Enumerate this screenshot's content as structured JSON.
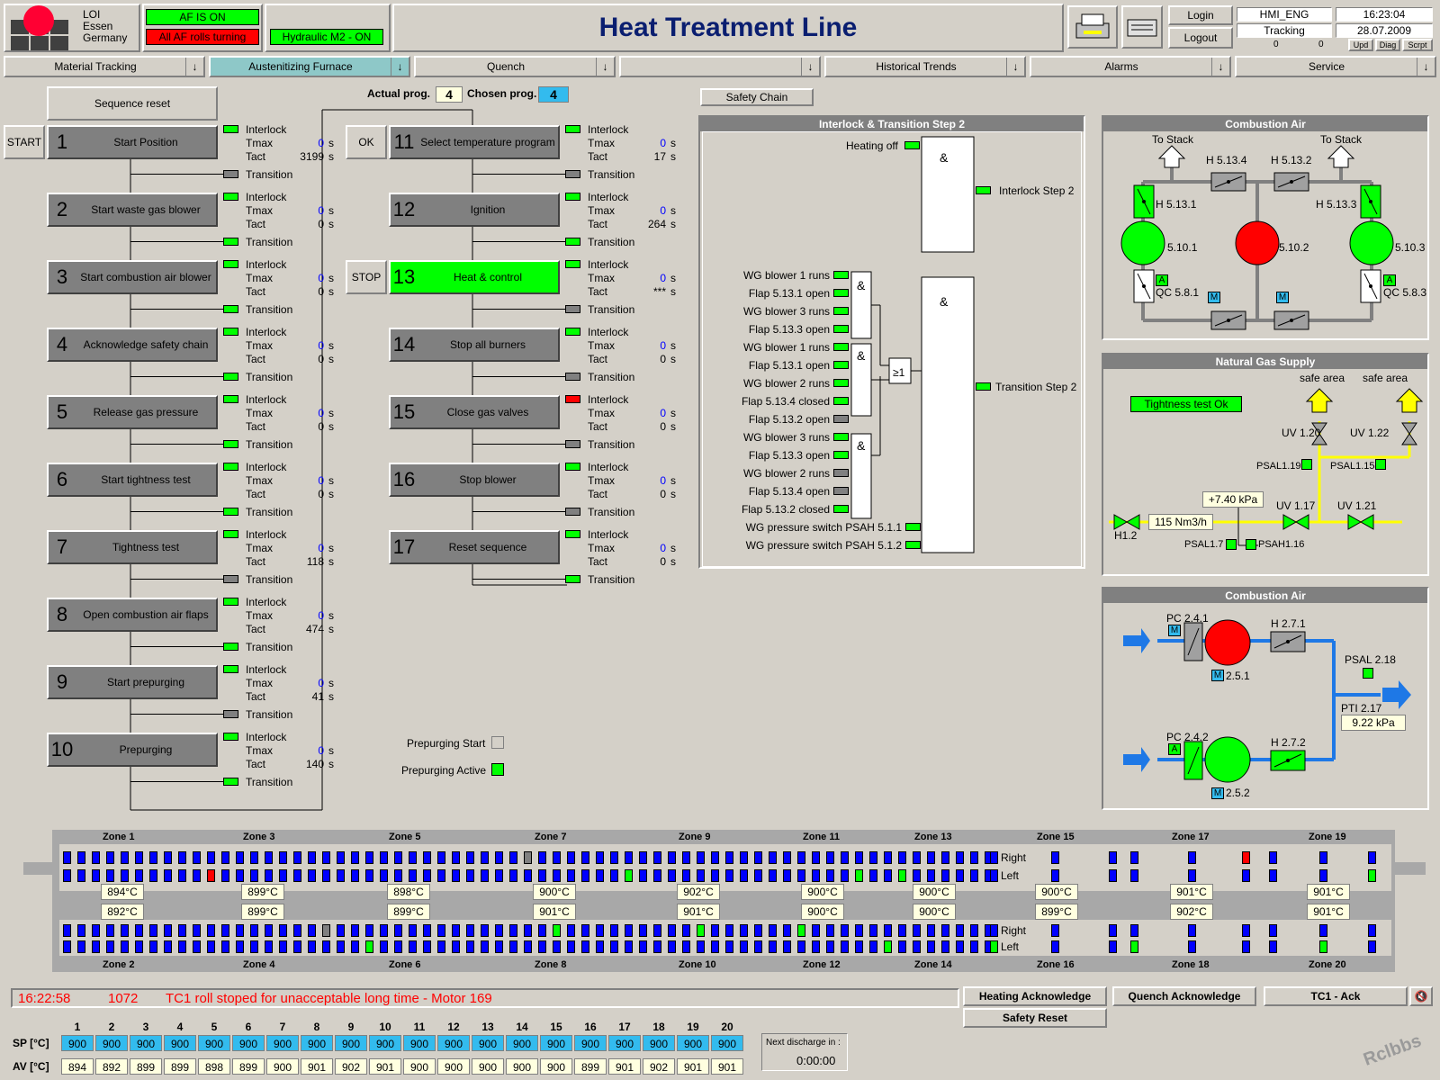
{
  "header": {
    "logo_text_1": "LOI",
    "logo_text_2": "Essen",
    "logo_text_3": "Germany",
    "status_af_on": "AF IS ON",
    "status_rolls": "All AF rolls turning",
    "status_hydraulic": "Hydraulic M2 - ON",
    "title": "Heat Treatment Line",
    "login": "Login",
    "logout": "Logout",
    "user": "HMI_ENG",
    "time": "16:23:04",
    "module": "Tracking",
    "date": "28.07.2009",
    "count_a": "0",
    "count_b": "0",
    "upd": "Upd",
    "diag": "Diag",
    "scrpt": "Scrpt"
  },
  "nav": [
    "Material Tracking",
    "Austenitizing Furnace",
    "Quench",
    "",
    "Historical Trends",
    "Alarms",
    "Service"
  ],
  "sequence": {
    "reset": "Sequence reset",
    "actual_label": "Actual prog.",
    "actual": "4",
    "chosen_label": "Chosen prog.",
    "chosen": "4",
    "start": "START",
    "ok": "OK",
    "stop": "STOP",
    "interlock": "Interlock",
    "tmax": "Tmax",
    "tact": "Tact",
    "transition": "Transition",
    "unit": "s",
    "steps": [
      {
        "n": "1",
        "label": "Start Position",
        "tmax": "0",
        "tact": "3199"
      },
      {
        "n": "2",
        "label": "Start waste gas blower",
        "tmax": "0",
        "tact": "0"
      },
      {
        "n": "3",
        "label": "Start combustion air blower",
        "tmax": "0",
        "tact": "0"
      },
      {
        "n": "4",
        "label": "Acknowledge safety chain",
        "tmax": "0",
        "tact": "0"
      },
      {
        "n": "5",
        "label": "Release gas pressure",
        "tmax": "0",
        "tact": "0"
      },
      {
        "n": "6",
        "label": "Start tightness test",
        "tmax": "0",
        "tact": "0"
      },
      {
        "n": "7",
        "label": "Tightness test",
        "tmax": "0",
        "tact": "118"
      },
      {
        "n": "8",
        "label": "Open combustion air flaps",
        "tmax": "0",
        "tact": "474"
      },
      {
        "n": "9",
        "label": "Start prepurging",
        "tmax": "0",
        "tact": "41"
      },
      {
        "n": "10",
        "label": "Prepurging",
        "tmax": "0",
        "tact": "140"
      },
      {
        "n": "11",
        "label": "Select temperature program",
        "tmax": "0",
        "tact": "17"
      },
      {
        "n": "12",
        "label": "Ignition",
        "tmax": "0",
        "tact": "264"
      },
      {
        "n": "13",
        "label": "Heat & control",
        "tmax": "0",
        "tact": "***"
      },
      {
        "n": "14",
        "label": "Stop all burners",
        "tmax": "0",
        "tact": "0"
      },
      {
        "n": "15",
        "label": "Close gas valves",
        "tmax": "0",
        "tact": "0"
      },
      {
        "n": "16",
        "label": "Stop blower",
        "tmax": "0",
        "tact": "0"
      },
      {
        "n": "17",
        "label": "Reset sequence",
        "tmax": "0",
        "tact": "0"
      }
    ],
    "prepurge_start": "Prepurging Start",
    "prepurge_active": "Prepurging Active"
  },
  "safety_chain": "Safety Chain",
  "interlock_panel": {
    "title": "Interlock & Transition Step 2",
    "heating_off": "Heating off",
    "interlock_step2": "Interlock Step 2",
    "transition_step2": "Transition Step 2",
    "and": "&",
    "or": "≥1",
    "inputs": [
      "WG blower 1 runs",
      "Flap 5.13.1 open",
      "WG blower 3 runs",
      "Flap 5.13.3 open",
      "WG blower 1 runs",
      "Flap 5.13.1 open",
      "WG blower 2 runs",
      "Flap 5.13.4 closed",
      "Flap 5.13.2 open",
      "WG blower 3 runs",
      "Flap 5.13.3 open",
      "WG blower 2 runs",
      "Flap 5.13.4 open",
      "Flap 5.13.2 closed",
      "WG pressure switch PSAH 5.1.1",
      "WG pressure switch PSAH 5.1.2"
    ]
  },
  "combustion_air_1": {
    "title": "Combustion Air",
    "to_stack": "To Stack",
    "h5134": "H 5.13.4",
    "h5132": "H 5.13.2",
    "h5131": "H 5.13.1",
    "h5133": "H 5.13.3",
    "b1": "5.10.1",
    "b2": "5.10.2",
    "b3": "5.10.3",
    "qc1": "QC 5.8.1",
    "qc3": "QC 5.8.3",
    "a": "A",
    "m": "M"
  },
  "natural_gas": {
    "title": "Natural Gas Supply",
    "safe_area": "safe area",
    "tightness": "Tightness test Ok",
    "uv120": "UV 1.20",
    "uv122": "UV 1.22",
    "psal119": "PSAL1.19",
    "psal115": "PSAL1.15",
    "pressure": "+7.40 kPa",
    "flow": "115 Nm3/h",
    "uv117": "UV 1.17",
    "uv121": "UV 1.21",
    "h12": "H1.2",
    "psal17": "PSAL1.7",
    "psah116": "PSAH1.16"
  },
  "combustion_air_2": {
    "title": "Combustion Air",
    "pc241": "PC 2.4.1",
    "h271": "H 2.7.1",
    "psal218": "PSAL 2.18",
    "m251": "2.5.1",
    "pti217": "PTI 2.17",
    "pti_val": "9.22 kPa",
    "pc242": "PC 2.4.2",
    "h272": "H 2.7.2",
    "m252": "2.5.2",
    "a": "A",
    "m": "M"
  },
  "zones": {
    "top": [
      "Zone 1",
      "Zone 3",
      "Zone 5",
      "Zone 7",
      "Zone 9",
      "Zone 11",
      "Zone 13",
      "Zone 15",
      "Zone 17",
      "Zone 19"
    ],
    "bottom": [
      "Zone 2",
      "Zone 4",
      "Zone 6",
      "Zone 8",
      "Zone 10",
      "Zone 12",
      "Zone 14",
      "Zone 16",
      "Zone 18",
      "Zone 20"
    ],
    "right": "Right",
    "left": "Left",
    "temps_top_a": [
      "894°C",
      "899°C",
      "898°C",
      "900°C",
      "902°C",
      "900°C",
      "900°C",
      "900°C",
      "901°C",
      "901°C"
    ],
    "temps_top_b": [
      "892°C",
      "899°C",
      "899°C",
      "901°C",
      "901°C",
      "900°C",
      "900°C",
      "899°C",
      "902°C",
      "901°C"
    ]
  },
  "alarm": {
    "time": "16:22:58",
    "code": "1072",
    "text": "TC1 roll stoped for unacceptable long time - Motor 169"
  },
  "ack": {
    "heating": "Heating Acknowledge",
    "quench": "Quench Acknowledge",
    "tc1": "TC1 - Ack",
    "safety": "Safety Reset"
  },
  "table": {
    "sp_label": "SP  [°C]",
    "av_label": "AV  [°C]",
    "cols": [
      "1",
      "2",
      "3",
      "4",
      "5",
      "6",
      "7",
      "8",
      "9",
      "10",
      "11",
      "12",
      "13",
      "14",
      "15",
      "16",
      "17",
      "18",
      "19",
      "20"
    ],
    "sp": [
      "900",
      "900",
      "900",
      "900",
      "900",
      "900",
      "900",
      "900",
      "900",
      "900",
      "900",
      "900",
      "900",
      "900",
      "900",
      "900",
      "900",
      "900",
      "900",
      "900"
    ],
    "av": [
      "894",
      "892",
      "899",
      "899",
      "898",
      "899",
      "900",
      "901",
      "902",
      "901",
      "900",
      "900",
      "900",
      "900",
      "900",
      "899",
      "901",
      "902",
      "901",
      "901"
    ]
  },
  "discharge": {
    "label": "Next discharge in :",
    "value": "0:00:00"
  },
  "watermark": "Rclbbs"
}
